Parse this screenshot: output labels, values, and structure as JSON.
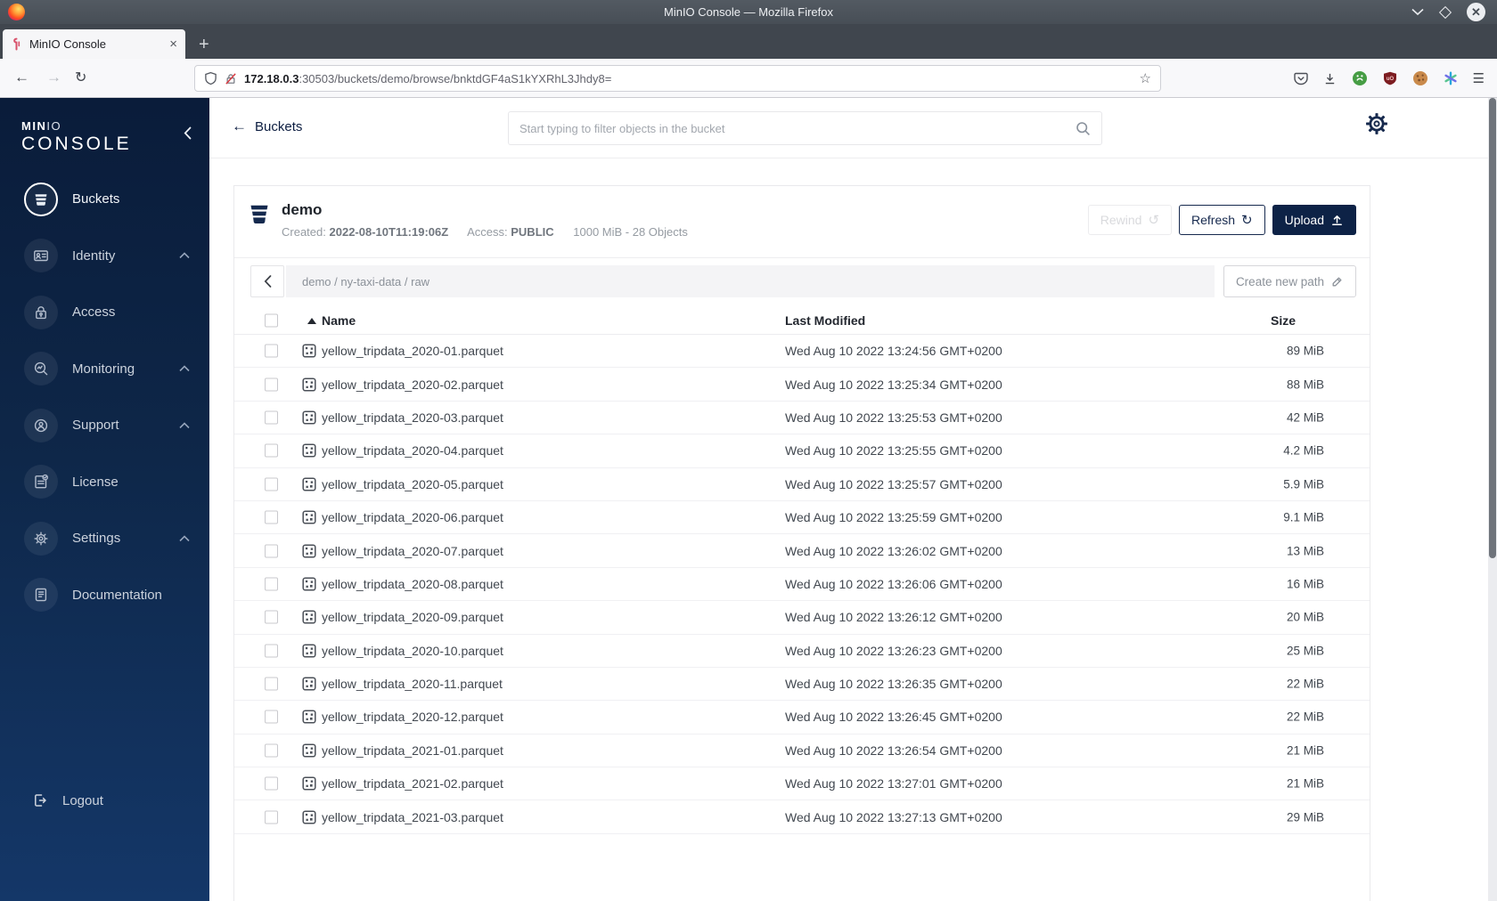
{
  "browser": {
    "window_title": "MinIO Console — Mozilla Firefox",
    "tab_title": "MinIO Console",
    "url_host": "172.18.0.3",
    "url_rest": ":30503/buckets/demo/browse/bnktdGF4aS1kYXRhL3Jhdy8="
  },
  "sidebar": {
    "logo_min": "MIN",
    "logo_io": "IO",
    "logo_console": "CONSOLE",
    "items": [
      {
        "label": "Buckets",
        "active": true
      },
      {
        "label": "Identity",
        "expandable": true
      },
      {
        "label": "Access"
      },
      {
        "label": "Monitoring",
        "expandable": true
      },
      {
        "label": "Support",
        "expandable": true
      },
      {
        "label": "License"
      },
      {
        "label": "Settings",
        "expandable": true
      },
      {
        "label": "Documentation"
      }
    ],
    "logout_label": "Logout"
  },
  "header": {
    "back_label": "Buckets",
    "search_placeholder": "Start typing to filter objects in the bucket"
  },
  "bucket": {
    "name": "demo",
    "created_label": "Created:",
    "created_value": "2022-08-10T11:19:06Z",
    "access_label": "Access:",
    "access_value": "PUBLIC",
    "summary": "1000 MiB - 28 Objects",
    "rewind_label": "Rewind",
    "refresh_label": "Refresh",
    "upload_label": "Upload",
    "rewind_icon": "↺",
    "refresh_icon": "↻"
  },
  "browse": {
    "breadcrumb": "demo / ny-taxi-data / raw",
    "create_path_label": "Create new path",
    "columns": {
      "name": "Name",
      "modified": "Last Modified",
      "size": "Size"
    },
    "rows": [
      {
        "name": "yellow_tripdata_2020-01.parquet",
        "modified": "Wed Aug 10 2022 13:24:56 GMT+0200",
        "size": "89 MiB"
      },
      {
        "name": "yellow_tripdata_2020-02.parquet",
        "modified": "Wed Aug 10 2022 13:25:34 GMT+0200",
        "size": "88 MiB"
      },
      {
        "name": "yellow_tripdata_2020-03.parquet",
        "modified": "Wed Aug 10 2022 13:25:53 GMT+0200",
        "size": "42 MiB"
      },
      {
        "name": "yellow_tripdata_2020-04.parquet",
        "modified": "Wed Aug 10 2022 13:25:55 GMT+0200",
        "size": "4.2 MiB"
      },
      {
        "name": "yellow_tripdata_2020-05.parquet",
        "modified": "Wed Aug 10 2022 13:25:57 GMT+0200",
        "size": "5.9 MiB"
      },
      {
        "name": "yellow_tripdata_2020-06.parquet",
        "modified": "Wed Aug 10 2022 13:25:59 GMT+0200",
        "size": "9.1 MiB"
      },
      {
        "name": "yellow_tripdata_2020-07.parquet",
        "modified": "Wed Aug 10 2022 13:26:02 GMT+0200",
        "size": "13 MiB"
      },
      {
        "name": "yellow_tripdata_2020-08.parquet",
        "modified": "Wed Aug 10 2022 13:26:06 GMT+0200",
        "size": "16 MiB"
      },
      {
        "name": "yellow_tripdata_2020-09.parquet",
        "modified": "Wed Aug 10 2022 13:26:12 GMT+0200",
        "size": "20 MiB"
      },
      {
        "name": "yellow_tripdata_2020-10.parquet",
        "modified": "Wed Aug 10 2022 13:26:23 GMT+0200",
        "size": "25 MiB"
      },
      {
        "name": "yellow_tripdata_2020-11.parquet",
        "modified": "Wed Aug 10 2022 13:26:35 GMT+0200",
        "size": "22 MiB"
      },
      {
        "name": "yellow_tripdata_2020-12.parquet",
        "modified": "Wed Aug 10 2022 13:26:45 GMT+0200",
        "size": "22 MiB"
      },
      {
        "name": "yellow_tripdata_2021-01.parquet",
        "modified": "Wed Aug 10 2022 13:26:54 GMT+0200",
        "size": "21 MiB"
      },
      {
        "name": "yellow_tripdata_2021-02.parquet",
        "modified": "Wed Aug 10 2022 13:27:01 GMT+0200",
        "size": "21 MiB"
      },
      {
        "name": "yellow_tripdata_2021-03.parquet",
        "modified": "Wed Aug 10 2022 13:27:13 GMT+0200",
        "size": "29 MiB"
      }
    ]
  }
}
